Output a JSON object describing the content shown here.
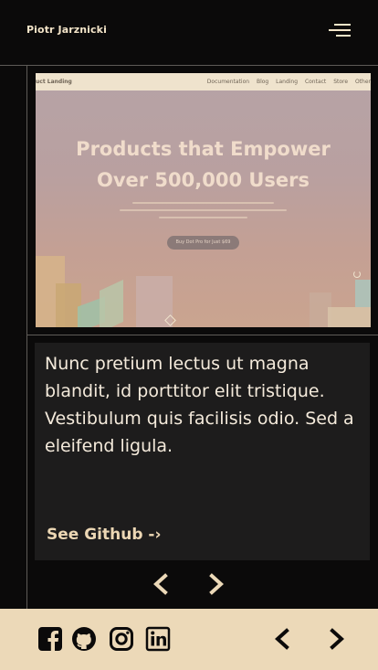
{
  "header": {
    "brand": "Piotr Jarznicki",
    "menu_icon": "hamburger-menu-icon"
  },
  "project": {
    "screenshot": {
      "nav_logo": "uct Landing",
      "nav_links": "Documentation Blog Landing Contact Store Other",
      "hero_title_line1": "Products that Empower",
      "hero_title_line2": "Over 500,000 Users",
      "hero_button": "Buy Dot Pro for Just $69"
    },
    "description": "Nunc pretium lectus ut magna blandit, id porttitor elit tristique. Vestibulum quis facilisis odio. Sed a eleifend ligula.",
    "link_label": "See Github -›"
  },
  "carousel": {
    "prev_icon": "chevron-left-icon",
    "next_icon": "chevron-right-icon"
  },
  "footer": {
    "social_icons": [
      "facebook-icon",
      "github-icon",
      "instagram-icon",
      "linkedin-icon"
    ],
    "prev_icon": "chevron-left-icon",
    "next_icon": "chevron-right-icon"
  },
  "colors": {
    "background": "#0b0a0a",
    "accent_cream": "#ecd9b8",
    "card": "#1d1c1c",
    "text_light": "#f3e4c8"
  }
}
